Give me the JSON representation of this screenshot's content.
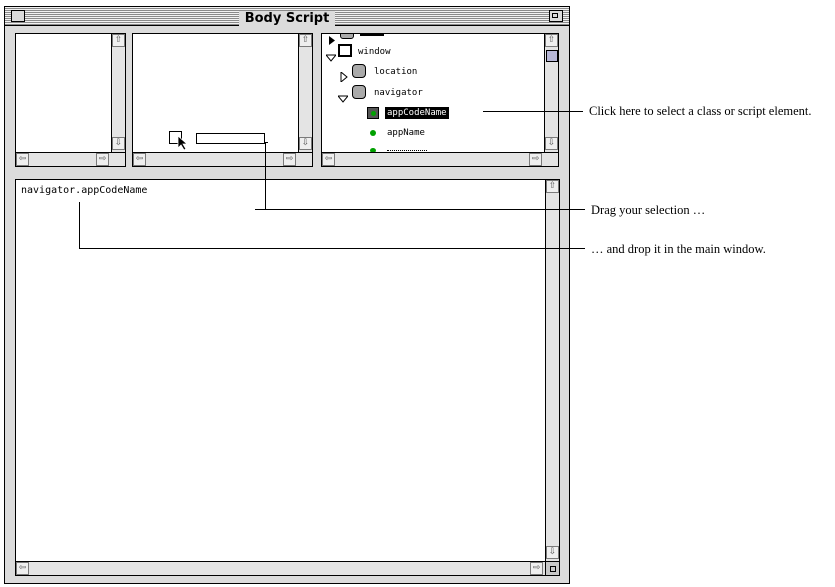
{
  "window": {
    "title": "Body Script"
  },
  "tree": {
    "items": [
      {
        "label": "",
        "icon": "closed-triangle",
        "kind": "clipped"
      },
      {
        "label": "window",
        "icon": "window-icon",
        "expanded": true
      },
      {
        "label": "location",
        "icon": "class-icon",
        "expanded": false
      },
      {
        "label": "navigator",
        "icon": "class-icon",
        "expanded": true
      },
      {
        "label": "appCodeName",
        "icon": "green-dot",
        "selected": true
      },
      {
        "label": "appName",
        "icon": "green-dot"
      },
      {
        "label": "",
        "icon": "green-dot",
        "kind": "clipped"
      }
    ]
  },
  "editor": {
    "code": "navigator.appCodeName"
  },
  "callouts": {
    "select": "Click here to select a class or script element.",
    "drag": "Drag your selection …",
    "drop": "… and drop it in the main window."
  },
  "colors": {
    "frame": "#000000",
    "chrome": "#dcdcdc",
    "pane": "#ffffff",
    "bullet": "#00a000"
  }
}
